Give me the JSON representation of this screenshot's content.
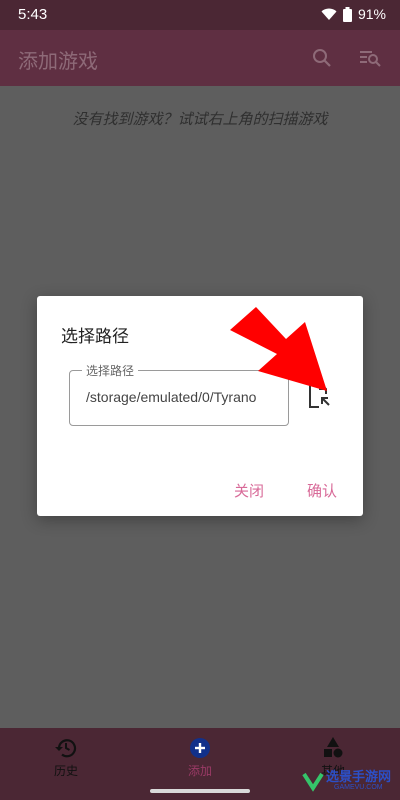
{
  "status_bar": {
    "time": "5:43",
    "battery": "91%"
  },
  "app_bar": {
    "title": "添加游戏"
  },
  "main": {
    "empty_message": "没有找到游戏？试试右上角的扫描游戏"
  },
  "dialog": {
    "title": "选择路径",
    "field_label": "选择路径",
    "field_value": "/storage/emulated/0/Tyrano",
    "close_label": "关闭",
    "confirm_label": "确认"
  },
  "bottom_nav": {
    "items": [
      {
        "label": "历史",
        "icon": "history-icon"
      },
      {
        "label": "添加",
        "icon": "add-circle-icon"
      },
      {
        "label": "其他",
        "icon": "shapes-icon"
      }
    ]
  },
  "watermark": {
    "text": "选景手游网",
    "sub": "GAMEVU.COM"
  },
  "colors": {
    "accent": "#d86a98",
    "app_bar": "#5f2f42",
    "annotation_arrow": "#ff0000"
  }
}
